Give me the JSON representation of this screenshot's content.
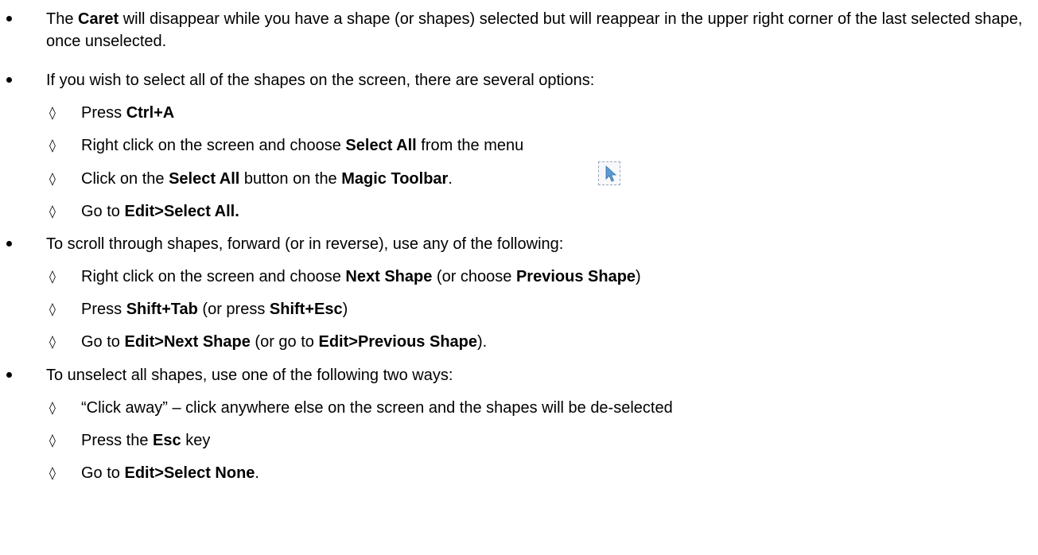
{
  "bullets": [
    {
      "parts": [
        {
          "t": "The ",
          "b": false
        },
        {
          "t": "Caret",
          "b": true
        },
        {
          "t": " will disappear while you have a shape (or shapes) selected but will reappear in the upper right corner of the last selected shape, once unselected.",
          "b": false
        }
      ]
    },
    {
      "parts": [
        {
          "t": " If you wish to select all of the shapes on the screen, there are several options:",
          "b": false
        }
      ],
      "subs": [
        [
          {
            "t": "Press ",
            "b": false
          },
          {
            "t": "Ctrl+A",
            "b": true
          }
        ],
        [
          {
            "t": "Right click on the screen and choose ",
            "b": false
          },
          {
            "t": "Select All",
            "b": true
          },
          {
            "t": " from the menu",
            "b": false
          }
        ],
        [
          {
            "t": "Click on the ",
            "b": false
          },
          {
            "t": "Select All",
            "b": true
          },
          {
            "t": " button on the ",
            "b": false
          },
          {
            "t": "Magic Toolbar",
            "b": true
          },
          {
            "t": ".",
            "b": false
          }
        ],
        [
          {
            "t": "Go to ",
            "b": false
          },
          {
            "t": "Edit>Select All.",
            "b": true
          }
        ]
      ]
    },
    {
      "parts": [
        {
          "t": "To scroll through shapes, forward (or in reverse), use any of the following:",
          "b": false
        }
      ],
      "subs": [
        [
          {
            "t": "Right click on the screen and choose ",
            "b": false
          },
          {
            "t": "Next Shape",
            "b": true
          },
          {
            "t": " (or choose ",
            "b": false
          },
          {
            "t": "Previous Shape",
            "b": true
          },
          {
            "t": ")",
            "b": false
          }
        ],
        [
          {
            "t": "Press ",
            "b": false
          },
          {
            "t": "Shift+Tab",
            "b": true
          },
          {
            "t": " (or press ",
            "b": false
          },
          {
            "t": "Shift+Esc",
            "b": true
          },
          {
            "t": ")",
            "b": false
          }
        ],
        [
          {
            "t": "Go to ",
            "b": false
          },
          {
            "t": "Edit>Next Shape",
            "b": true
          },
          {
            "t": " (or go to ",
            "b": false
          },
          {
            "t": "Edit>Previous Shape",
            "b": true
          },
          {
            "t": ").",
            "b": false
          }
        ]
      ]
    },
    {
      "parts": [
        {
          "t": "To unselect all shapes, use one of the following two ways:",
          "b": false
        }
      ],
      "subs": [
        [
          {
            "t": "“Click away” – click anywhere else on the screen and the shapes will be de-selected",
            "b": false
          }
        ],
        [
          {
            "t": "Press the ",
            "b": false
          },
          {
            "t": "Esc",
            "b": true
          },
          {
            "t": " key",
            "b": false
          }
        ],
        [
          {
            "t": "Go to ",
            "b": false
          },
          {
            "t": "Edit>Select None",
            "b": true
          },
          {
            "t": ".",
            "b": false
          }
        ]
      ]
    }
  ],
  "sub_marker": "◊",
  "icons": {
    "select_all_toolbar_icon": "select-all-arrow-icon"
  },
  "colors": {
    "icon_arrow": "#5b9bd5",
    "icon_border": "#9aa7b5"
  }
}
